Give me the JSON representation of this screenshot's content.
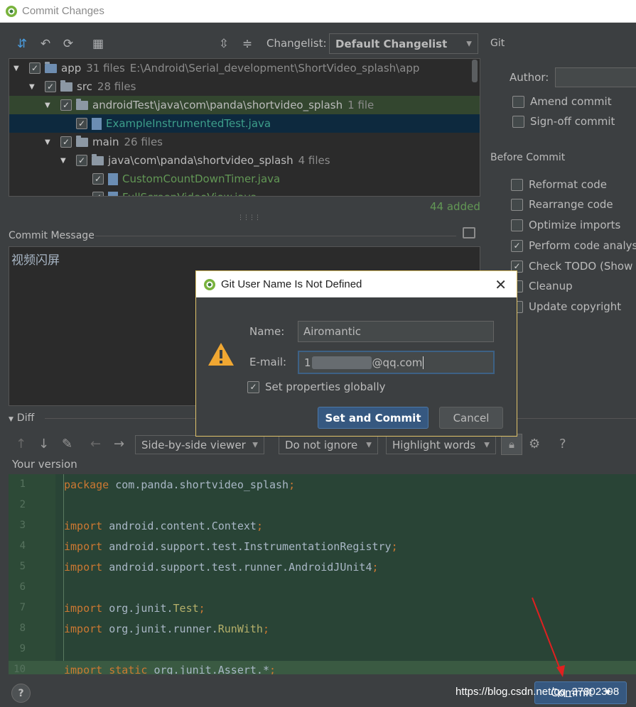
{
  "window": {
    "title": "Commit Changes"
  },
  "toolbar": {
    "changelist_label": "Changelist:",
    "changelist_value": "Default Changelist"
  },
  "tree": {
    "rows": [
      {
        "name": "app",
        "count": "31 files",
        "path": "E:\\Android\\Serial_development\\ShortVideo_splash\\app"
      },
      {
        "name": "src",
        "count": "28 files"
      },
      {
        "name": "androidTest\\java\\com\\panda\\shortvideo_splash",
        "count": "1 file"
      },
      {
        "name": "ExampleInstrumentedTest.java"
      },
      {
        "name": "main",
        "count": "26 files"
      },
      {
        "name": "java\\com\\panda\\shortvideo_splash",
        "count": "4 files"
      },
      {
        "name": "CustomCountDownTimer.java"
      },
      {
        "name": "FullScreenVideoView.java"
      }
    ],
    "added_summary": "44 added"
  },
  "commit_message": {
    "label": "Commit Message",
    "text": "视频闪屏"
  },
  "git_panel": {
    "title": "Git",
    "author_label": "Author:",
    "amend_label": "Amend commit",
    "signoff_label": "Sign-off commit"
  },
  "before_commit": {
    "title": "Before Commit",
    "options": [
      {
        "label": "Reformat code",
        "checked": false
      },
      {
        "label": "Rearrange code",
        "checked": false
      },
      {
        "label": "Optimize imports",
        "checked": false
      },
      {
        "label": "Perform code analysis",
        "checked": true
      },
      {
        "label": "Check TODO (Show All)",
        "checked": true
      },
      {
        "label": "Cleanup",
        "checked": false
      },
      {
        "label": "Update copyright",
        "checked": false
      }
    ]
  },
  "diff": {
    "label": "Diff",
    "viewer": "Side-by-side viewer",
    "ignore": "Do not ignore",
    "highlight": "Highlight words",
    "your_version": "Your version",
    "help": "?",
    "lines": [
      {
        "n": "1",
        "parts": [
          [
            "kw",
            "package "
          ],
          [
            "t",
            "com.panda.shortvideo_splash"
          ],
          [
            "kw",
            ";"
          ]
        ]
      },
      {
        "n": "2",
        "parts": []
      },
      {
        "n": "3",
        "parts": [
          [
            "kw",
            "import "
          ],
          [
            "t",
            "android.content.Context"
          ],
          [
            "kw",
            ";"
          ]
        ]
      },
      {
        "n": "4",
        "parts": [
          [
            "kw",
            "import "
          ],
          [
            "t",
            "android.support.test.InstrumentationRegistry"
          ],
          [
            "kw",
            ";"
          ]
        ]
      },
      {
        "n": "5",
        "parts": [
          [
            "kw",
            "import "
          ],
          [
            "t",
            "android.support.test.runner.AndroidJUnit4"
          ],
          [
            "kw",
            ";"
          ]
        ]
      },
      {
        "n": "6",
        "parts": []
      },
      {
        "n": "7",
        "parts": [
          [
            "kw",
            "import "
          ],
          [
            "t",
            "org.junit."
          ],
          [
            "cls",
            "Test"
          ],
          [
            "kw",
            ";"
          ]
        ]
      },
      {
        "n": "8",
        "parts": [
          [
            "kw",
            "import "
          ],
          [
            "t",
            "org.junit.runner."
          ],
          [
            "cls",
            "RunWith"
          ],
          [
            "kw",
            ";"
          ]
        ]
      },
      {
        "n": "9",
        "parts": []
      },
      {
        "n": "10",
        "parts": [
          [
            "kw",
            "import static "
          ],
          [
            "t",
            "org.junit.Assert.*"
          ],
          [
            "kw",
            ";"
          ]
        ]
      }
    ]
  },
  "footer": {
    "help": "?",
    "commit_label": "Commit",
    "watermark": "https://blog.csdn.net/qq_37802398"
  },
  "dialog": {
    "title": "Git User Name Is Not Defined",
    "close": "✕",
    "name_label": "Name:",
    "name_value": "Airomantic",
    "email_label": "E-mail:",
    "email_prefix": "1",
    "email_suffix": "@qq.com",
    "checkbox_label": "Set properties globally",
    "primary_button": "Set and Commit",
    "secondary_button": "Cancel"
  },
  "colors": {
    "background": "#3c3f41",
    "editor": "#2b2b2b",
    "diff_added": "#294436",
    "accent_button": "#365880",
    "added_text": "#629755"
  }
}
